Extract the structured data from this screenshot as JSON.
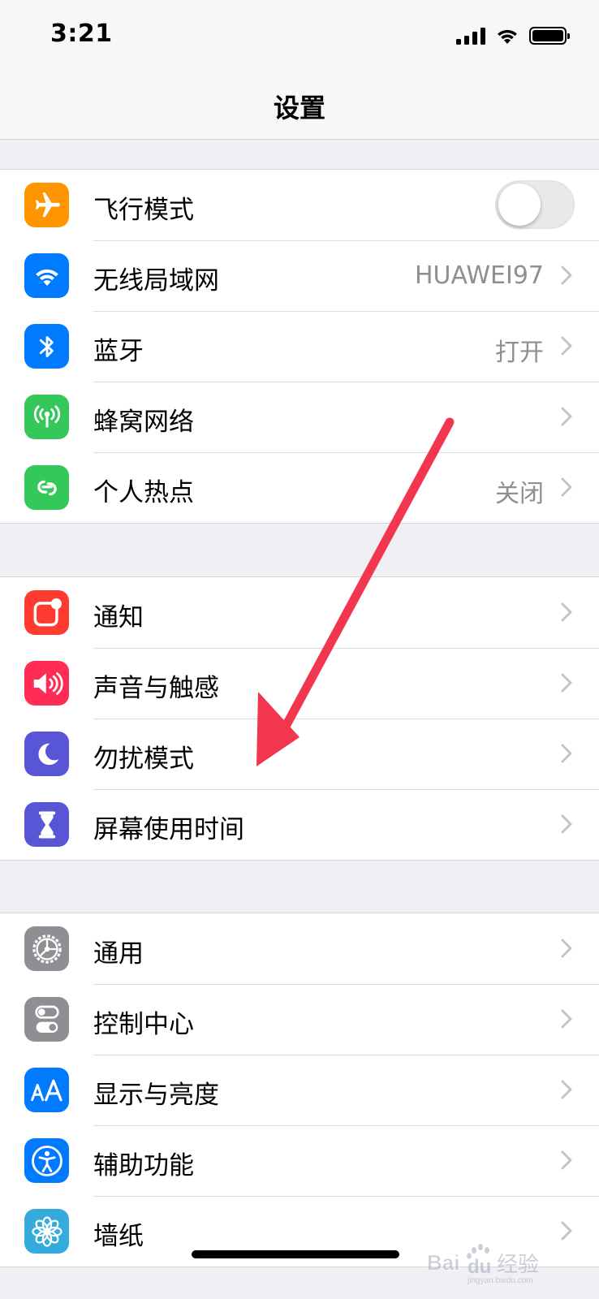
{
  "status_bar": {
    "time": "3:21"
  },
  "nav": {
    "title": "设置"
  },
  "groups": [
    {
      "rows": [
        {
          "label": "飞行模式",
          "icon": "airplane-icon",
          "color": "#ff9500",
          "control": "toggle",
          "toggle_on": false
        },
        {
          "label": "无线局域网",
          "icon": "wifi-icon",
          "color": "#007aff",
          "value": "HUAWEI97"
        },
        {
          "label": "蓝牙",
          "icon": "bluetooth-icon",
          "color": "#007aff",
          "value": "打开"
        },
        {
          "label": "蜂窝网络",
          "icon": "antenna-icon",
          "color": "#34c759"
        },
        {
          "label": "个人热点",
          "icon": "hotspot-icon",
          "color": "#34c759",
          "value": "关闭"
        }
      ]
    },
    {
      "rows": [
        {
          "label": "通知",
          "icon": "notifications-icon",
          "color": "#ff3b30"
        },
        {
          "label": "声音与触感",
          "icon": "speaker-icon",
          "color": "#ff2d55"
        },
        {
          "label": "勿扰模式",
          "icon": "moon-icon",
          "color": "#5856d6"
        },
        {
          "label": "屏幕使用时间",
          "icon": "hourglass-icon",
          "color": "#5856d6"
        }
      ]
    },
    {
      "rows": [
        {
          "label": "通用",
          "icon": "gear-icon",
          "color": "#8e8e93"
        },
        {
          "label": "控制中心",
          "icon": "switches-icon",
          "color": "#8e8e93"
        },
        {
          "label": "显示与亮度",
          "icon": "text-size-icon",
          "color": "#007aff"
        },
        {
          "label": "辅助功能",
          "icon": "accessibility-icon",
          "color": "#007aff"
        },
        {
          "label": "墙纸",
          "icon": "flower-icon",
          "color": "#35aadc"
        }
      ]
    }
  ],
  "annotation": {
    "color": "#f2364f"
  },
  "watermark": {
    "text": "Baidu经验"
  }
}
